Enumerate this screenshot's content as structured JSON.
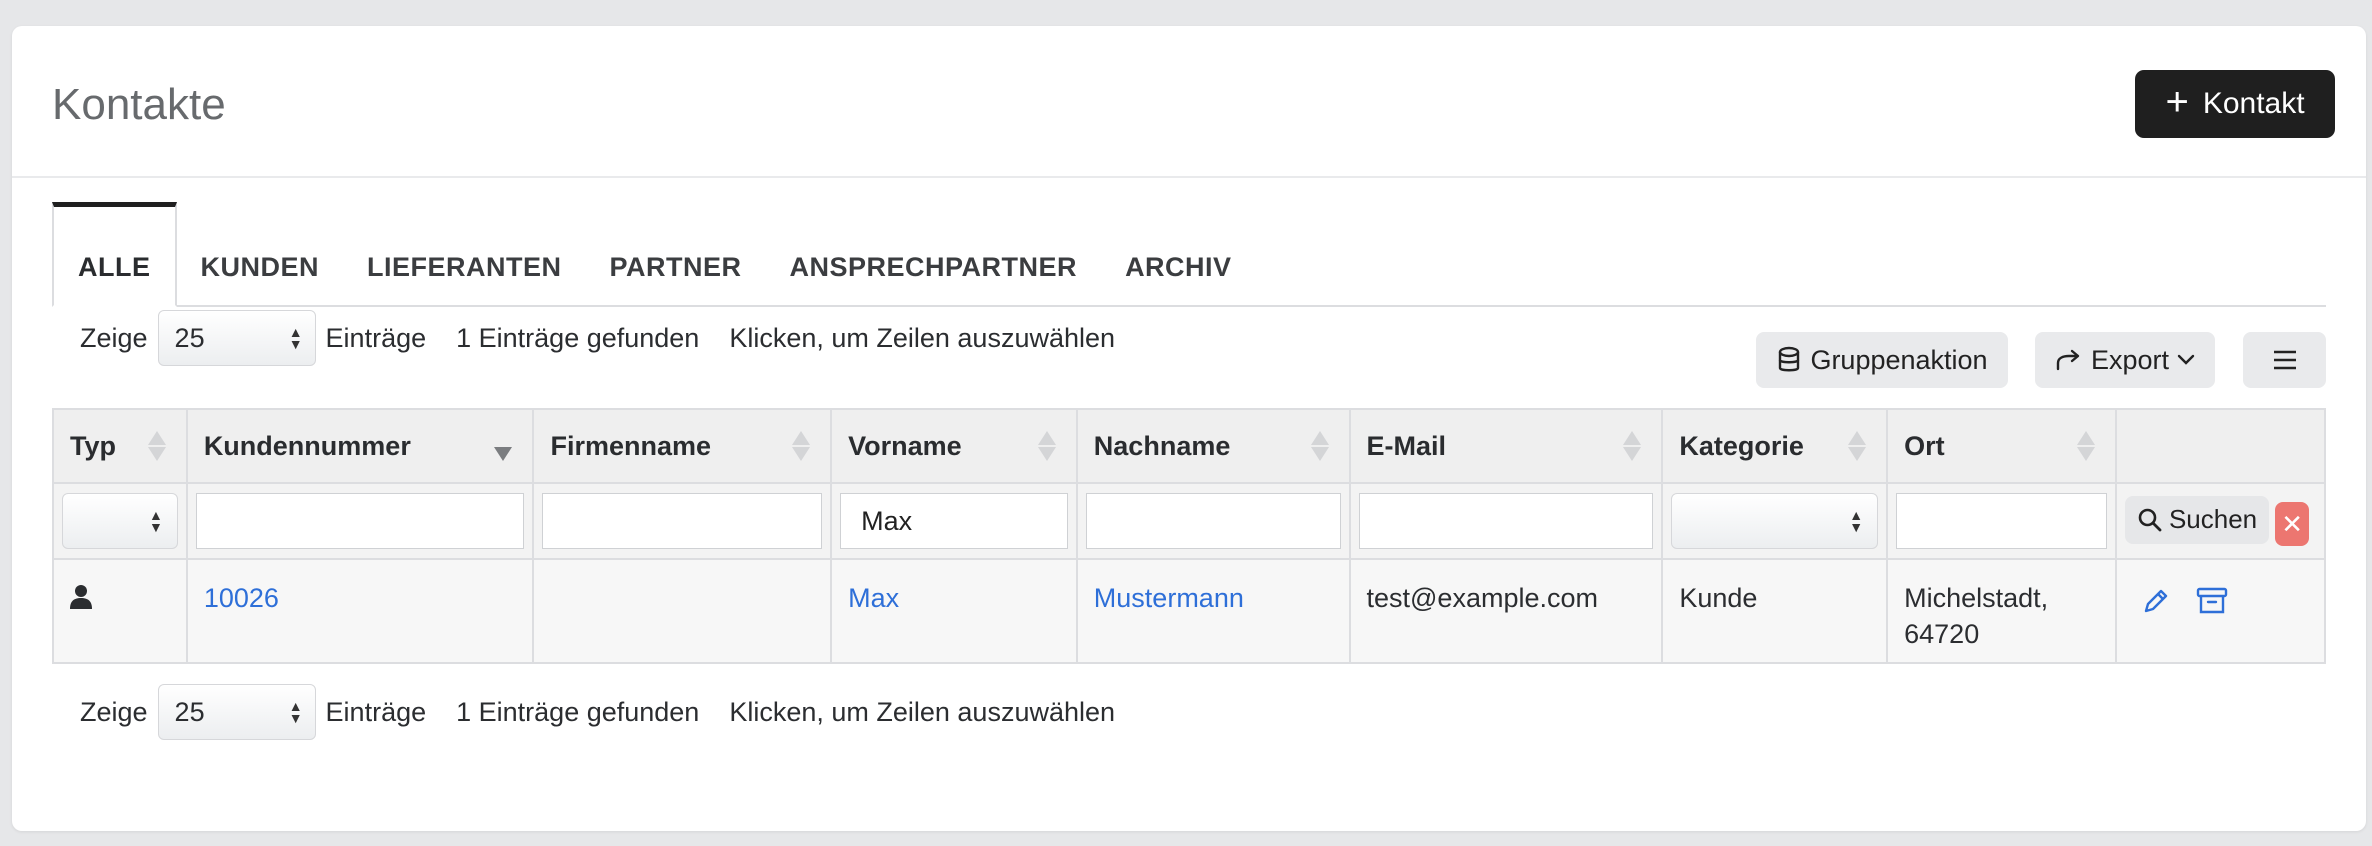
{
  "header": {
    "title": "Kontakte",
    "add_button": "Kontakt"
  },
  "tabs": [
    {
      "label": "ALLE",
      "active": true
    },
    {
      "label": "KUNDEN"
    },
    {
      "label": "LIEFERANTEN"
    },
    {
      "label": "PARTNER"
    },
    {
      "label": "ANSPRECHPARTNER"
    },
    {
      "label": "ARCHIV"
    }
  ],
  "pagination_top": {
    "show_label": "Zeige",
    "page_size": "25",
    "entries_label": "Einträge",
    "found": "1 Einträge gefunden",
    "hint": "Klicken, um Zeilen auszuwählen"
  },
  "pagination_bottom": {
    "show_label": "Zeige",
    "page_size": "25",
    "entries_label": "Einträge",
    "found": "1 Einträge gefunden",
    "hint": "Klicken, um Zeilen auszuwählen"
  },
  "toolbar": {
    "group_action": "Gruppenaktion",
    "export": "Export",
    "menu_icon": "hamburger-icon"
  },
  "table": {
    "columns": [
      "Typ",
      "Kundennummer",
      "Firmenname",
      "Vorname",
      "Nachname",
      "E-Mail",
      "Kategorie",
      "Ort"
    ],
    "sorted_column": "Kundennummer",
    "filters": {
      "vorname": "Max",
      "search_button": "Suchen"
    },
    "rows": [
      {
        "typ_icon": "person-icon",
        "kundennummer": "10026",
        "firmenname": "",
        "vorname": "Max",
        "nachname": "Mustermann",
        "email": "test@example.com",
        "kategorie": "Kunde",
        "ort_line1": "Michelstadt,",
        "ort_line2": "64720"
      }
    ]
  },
  "colors": {
    "link": "#2e6fd8",
    "primary_button": "#1f1f1f",
    "clear_button": "#ec7670"
  }
}
